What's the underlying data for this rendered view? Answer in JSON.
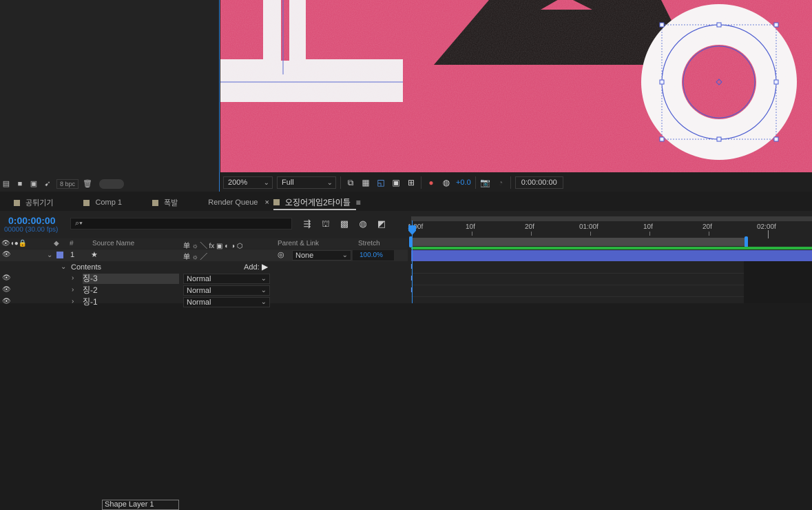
{
  "project": {
    "bpc": "8 bpc"
  },
  "viewer": {
    "zoom": "200%",
    "resolution": "Full",
    "exposure": "+0.0",
    "time": "0:00:00:00"
  },
  "tabs": [
    {
      "label": "공튀기기",
      "swatch": true
    },
    {
      "label": "Comp 1",
      "swatch": true
    },
    {
      "label": "폭발",
      "swatch": true
    },
    {
      "label": "Render Queue",
      "swatch": false
    },
    {
      "label": "오징어게임2타이틀",
      "swatch": true,
      "active": true
    }
  ],
  "timeline": {
    "timecode": "0:00:00:00",
    "fps": "00000 (30.00 fps)",
    "search_placeholder": "",
    "ruler_labels": [
      "1:00f",
      "10f",
      "20f",
      "01:00f",
      "10f",
      "20f",
      "02:00f"
    ],
    "columns": {
      "hash": "#",
      "source_name": "Source Name",
      "switches": "单 ☼ ╲ fx ▣ ◐ ◑ ⬡",
      "parent": "Parent & Link",
      "stretch": "Stretch"
    },
    "layer": {
      "index": "1",
      "name": "Shape Layer 1",
      "parent": "None",
      "stretch": "100.0%",
      "label_color": "#6b7fd7"
    },
    "contents_label": "Contents",
    "add_label": "Add:",
    "sublayers": [
      {
        "name": "징-3",
        "mode": "Normal"
      },
      {
        "name": "징-2",
        "mode": "Normal"
      },
      {
        "name": "징-1",
        "mode": "Normal"
      }
    ]
  },
  "colors": {
    "accent": "#2f8ff0",
    "canvas_bg": "#d9456f",
    "layer_bar": "#5162c9",
    "green": "#29b33e"
  }
}
